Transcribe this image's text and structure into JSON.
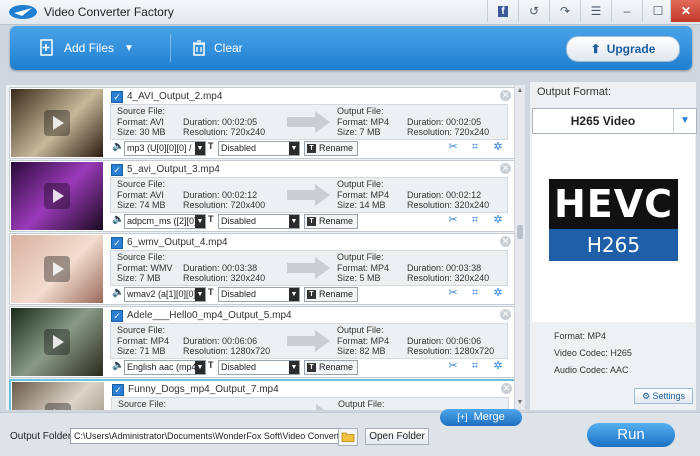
{
  "window": {
    "title": "Video Converter Factory"
  },
  "toolbar": {
    "add_files": "Add Files",
    "clear": "Clear",
    "upgrade": "Upgrade"
  },
  "labels": {
    "source_file": "Source File:",
    "output_file": "Output File:",
    "format": "Format:",
    "size": "Size:",
    "duration": "Duration:",
    "resolution": "Resolution:",
    "rename": "Rename"
  },
  "files": [
    {
      "name": "4_AVI_Output_2.mp4",
      "src_format": "AVI",
      "src_size": "30 MB",
      "src_duration": "00:02:05",
      "src_resolution": "720x240",
      "out_format": "MP4",
      "out_size": "7 MB",
      "out_duration": "00:02:05",
      "out_resolution": "720x240",
      "audio": "mp3 (U[0][0][0] / ...",
      "subtitle": "Disabled"
    },
    {
      "name": "5_avi_Output_3.mp4",
      "src_format": "AVI",
      "src_size": "74 MB",
      "src_duration": "00:02:12",
      "src_resolution": "720x400",
      "out_format": "MP4",
      "out_size": "14 MB",
      "out_duration": "00:02:12",
      "out_resolution": "320x240",
      "audio": "adpcm_ms ([2][0]...",
      "subtitle": "Disabled"
    },
    {
      "name": "6_wmv_Output_4.mp4",
      "src_format": "WMV",
      "src_size": "7 MB",
      "src_duration": "00:03:38",
      "src_resolution": "320x240",
      "out_format": "MP4",
      "out_size": "5 MB",
      "out_duration": "00:03:38",
      "out_resolution": "320x240",
      "audio": "wmav2 (a[1][0][0]...",
      "subtitle": "Disabled"
    },
    {
      "name": "Adele___Hello0_mp4_Output_5.mp4",
      "src_format": "MP4",
      "src_size": "71 MB",
      "src_duration": "00:06:06",
      "src_resolution": "1280x720",
      "out_format": "MP4",
      "out_size": "82 MB",
      "out_duration": "00:06:06",
      "out_resolution": "1280x720",
      "audio": "English aac (mp4...",
      "subtitle": "Disabled"
    },
    {
      "name": "Funny_Dogs_mp4_Output_7.mp4"
    }
  ],
  "output_panel": {
    "label": "Output Format:",
    "selected": "H265 Video",
    "logo_top": "HEVC",
    "logo_bottom": "H265",
    "format": "Format: MP4",
    "video_codec": "Video Codec: H265",
    "audio_codec": "Audio Codec: AAC",
    "settings": "Settings"
  },
  "bottom": {
    "merge": "Merge",
    "output_folder_label": "Output Folder:",
    "output_folder_path": "C:\\Users\\Administrator\\Documents\\WonderFox Soft\\Video Converter Factory\\",
    "open_folder": "Open Folder",
    "run": "Run"
  },
  "colors": {
    "accent": "#1f7fd0",
    "panel": "#eef1f4",
    "selected_border": "#6bc0e0"
  }
}
